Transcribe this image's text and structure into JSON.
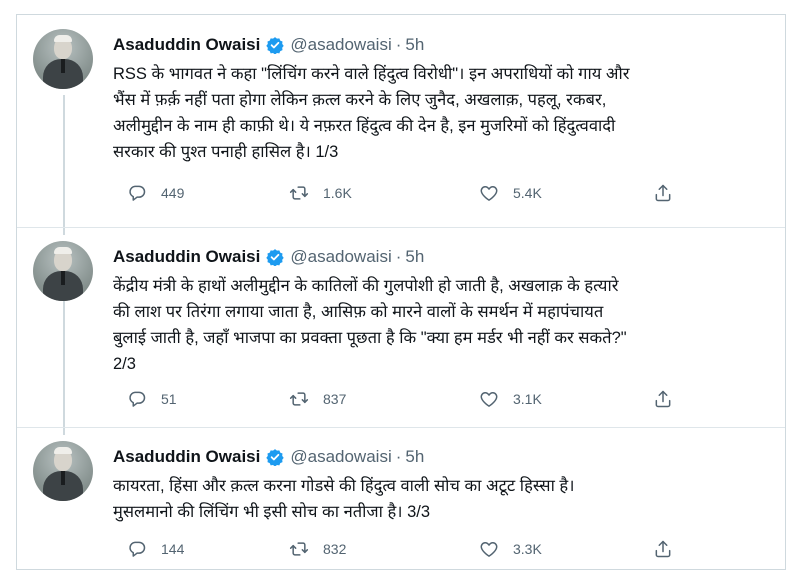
{
  "tweets": [
    {
      "name": "Asaduddin Owaisi",
      "handle": "@asadowaisi",
      "dot": "·",
      "time": "5h",
      "lines": [
        "RSS के भागवत ने कहा \"लिंचिंग करने वाले हिंदुत्व विरोधी\"। इन अपराधियों को गाय और",
        "भैंस में फ़र्क़ नहीं पता होगा लेकिन क़त्ल करने के लिए जुनैद, अखलाक़, पहलू, रकबर,",
        "अलीमुद्दीन के नाम ही काफ़ी थे। ये नफ़रत हिंदुत्व की देन है, इन मुजरिमों को हिंदुत्ववादी",
        "सरकार की पुश्त पनाही हासिल है। 1/3"
      ],
      "replies": "449",
      "retweets": "1.6K",
      "likes": "5.4K"
    },
    {
      "name": "Asaduddin Owaisi",
      "handle": "@asadowaisi",
      "dot": "·",
      "time": "5h",
      "lines": [
        "केंद्रीय मंत्री के हाथों अलीमुद्दीन के कातिलों की गुलपोशी हो जाती है, अखलाक़ के हत्यारे",
        "की लाश पर तिरंगा लगाया जाता है, आसिफ़ को मारने वालों के समर्थन में महापंचायत",
        "बुलाई जाती है, जहाँ भाजपा का प्रवक्ता पूछता है कि \"क्या हम मर्डर भी नहीं कर सकते?\"",
        "2/3"
      ],
      "replies": "51",
      "retweets": "837",
      "likes": "3.1K"
    },
    {
      "name": "Asaduddin Owaisi",
      "handle": "@asadowaisi",
      "dot": "·",
      "time": "5h",
      "lines": [
        "कायरता, हिंसा और क़त्ल करना गोडसे की हिंदुत्व वाली सोच का अटूट हिस्सा है।",
        "मुसलमानो की लिंचिंग भी इसी सोच का नतीजा है। 3/3"
      ],
      "replies": "144",
      "retweets": "832",
      "likes": "3.3K"
    }
  ],
  "icons": {
    "verified": "verified-badge-icon",
    "reply": "reply-icon",
    "retweet": "retweet-icon",
    "like": "like-icon",
    "share": "share-icon"
  },
  "colors": {
    "verified_blue": "#1d9bf0",
    "muted": "#536471",
    "border": "#cfd9de"
  }
}
